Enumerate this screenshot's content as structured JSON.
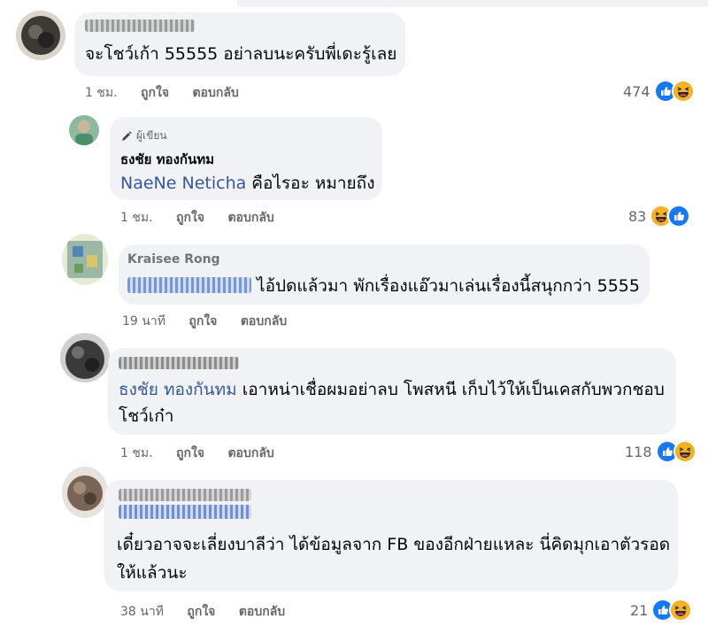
{
  "comments": [
    {
      "text": "จะโชว์เก้า 55555 อย่าลบนะครับพี่เดะรู้เลย",
      "time": "1 ชม.",
      "like": "ถูกใจ",
      "reply": "ตอบกลับ",
      "reaction_count": "474"
    },
    {
      "author_tag": "ผู้เขียน",
      "author": "ธงชัย ทองกันทม",
      "mention": "NaeNe Neticha",
      "text": "คือไรอะ หมายถึง",
      "time": "1 ชม.",
      "like": "ถูกใจ",
      "reply": "ตอบกลับ",
      "reaction_count": "83"
    },
    {
      "author": "Kraisee Rong",
      "text": "ไอ้ปดแล้วมา พักเรื่องแอ๊วมาเล่นเรื่องนี้สนุกกว่า 5555",
      "time": "19 นาที",
      "like": "ถูกใจ",
      "reply": "ตอบกลับ"
    },
    {
      "mention": "ธงชัย ทองกันทม",
      "text_line1": "เอาหน่าเชื่อผมอย่าลบ โพสหนี เก็บไว้ให้เป็นเคสกับพวกชอบ",
      "text_line2": "โชว์เก๋า",
      "time": "1 ชม.",
      "like": "ถูกใจ",
      "reply": "ตอบกลับ",
      "reaction_count": "118"
    },
    {
      "text_line1": "เดี๋ยวอาจจะเลี่ยงบาลีว่า ได้ข้อมูลจาก FB ของอีกฝ่ายแหละ นี่คิดมุกเอาตัวรอด",
      "text_line2": "ให้แล้วนะ",
      "time": "38 นาที",
      "like": "ถูกใจ",
      "reply": "ตอบกลับ",
      "reaction_count": "21"
    }
  ],
  "colors": {
    "bubble": "#f0f2f5",
    "mention": "#385898",
    "meta": "#65676b",
    "like_blue": "#1877f2",
    "haha_yellow": "#f7b125"
  },
  "icons": [
    "like-reaction-icon",
    "haha-reaction-icon",
    "pencil-icon"
  ]
}
